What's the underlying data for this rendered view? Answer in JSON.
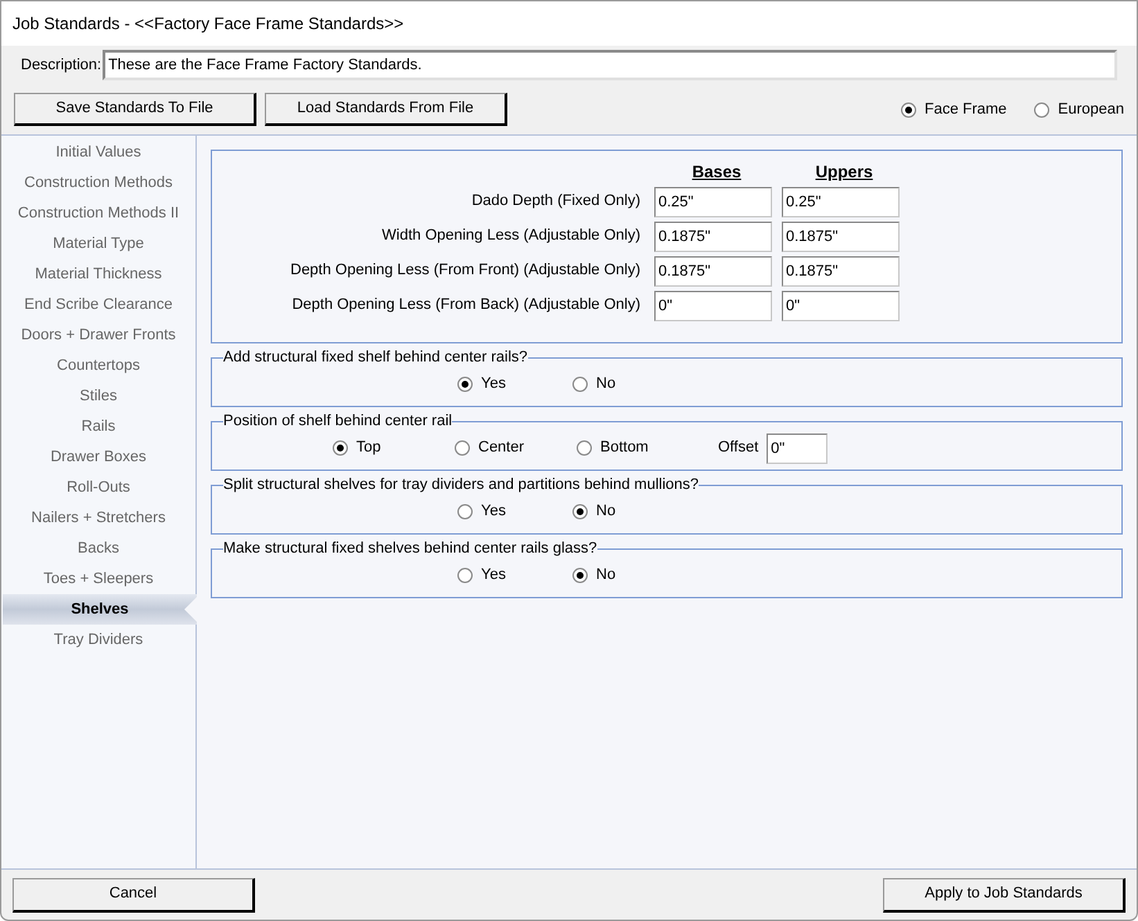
{
  "window": {
    "title": "Job Standards - <<Factory Face Frame Standards>>"
  },
  "description": {
    "label": "Description:",
    "value": "These are the Face Frame Factory Standards."
  },
  "file_buttons": [
    "Save Standards To File",
    "Load Standards From File"
  ],
  "style_options": [
    {
      "label": "Face Frame",
      "selected": true
    },
    {
      "label": "European",
      "selected": false
    }
  ],
  "sidebar": {
    "items": [
      {
        "label": "Initial Values",
        "selected": false
      },
      {
        "label": "Construction Methods",
        "selected": false
      },
      {
        "label": "Construction Methods II",
        "selected": false
      },
      {
        "label": "Material Type",
        "selected": false
      },
      {
        "label": "Material Thickness",
        "selected": false
      },
      {
        "label": "End Scribe Clearance",
        "selected": false
      },
      {
        "label": "Doors + Drawer Fronts",
        "selected": false
      },
      {
        "label": "Countertops",
        "selected": false
      },
      {
        "label": "Stiles",
        "selected": false
      },
      {
        "label": "Rails",
        "selected": false
      },
      {
        "label": "Drawer Boxes",
        "selected": false
      },
      {
        "label": "Roll-Outs",
        "selected": false
      },
      {
        "label": "Nailers + Stretchers",
        "selected": false
      },
      {
        "label": "Backs",
        "selected": false
      },
      {
        "label": "Toes + Sleepers",
        "selected": false
      },
      {
        "label": "Shelves",
        "selected": true
      },
      {
        "label": "Tray Dividers",
        "selected": false
      }
    ]
  },
  "dimensions": {
    "columns": [
      "Bases",
      "Uppers"
    ],
    "rows": [
      {
        "label": "Dado Depth (Fixed Only)",
        "bases": "0.25\"",
        "uppers": "0.25\""
      },
      {
        "label": "Width Opening Less (Adjustable Only)",
        "bases": "0.1875\"",
        "uppers": "0.1875\""
      },
      {
        "label": "Depth Opening Less (From Front) (Adjustable Only)",
        "bases": "0.1875\"",
        "uppers": "0.1875\""
      },
      {
        "label": "Depth Opening Less (From Back) (Adjustable Only)",
        "bases": "0\"",
        "uppers": "0\""
      }
    ]
  },
  "groups": [
    {
      "kind": "choice",
      "title": "Add structural fixed shelf behind center rails?",
      "options": [
        {
          "label": "Yes",
          "selected": true
        },
        {
          "label": "No",
          "selected": false
        }
      ]
    },
    {
      "kind": "position",
      "title": "Position of shelf behind center rail",
      "options": [
        {
          "label": "Top",
          "selected": true
        },
        {
          "label": "Center",
          "selected": false
        },
        {
          "label": "Bottom",
          "selected": false
        }
      ],
      "offset": {
        "label": "Offset",
        "value": "0\""
      }
    },
    {
      "kind": "choice",
      "title": "Split structural shelves for tray dividers and partitions behind mullions?",
      "options": [
        {
          "label": "Yes",
          "selected": false
        },
        {
          "label": "No",
          "selected": true
        }
      ]
    },
    {
      "kind": "choice",
      "title": "Make structural fixed shelves behind center rails glass?",
      "options": [
        {
          "label": "Yes",
          "selected": false
        },
        {
          "label": "No",
          "selected": true
        }
      ]
    }
  ],
  "footer_buttons": [
    "Cancel",
    "Apply to Job Standards"
  ]
}
